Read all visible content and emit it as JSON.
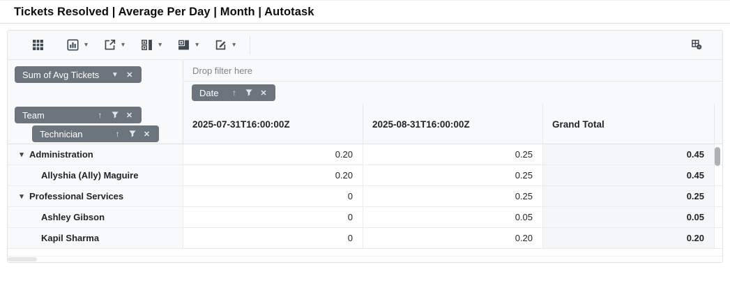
{
  "page": {
    "title": "Tickets Resolved | Average Per Day | Month | Autotask"
  },
  "toolbar": {
    "icons": [
      {
        "name": "grid-view-icon",
        "dropdown": false
      },
      {
        "name": "chart-view-icon",
        "dropdown": true
      },
      {
        "name": "export-icon",
        "dropdown": true
      },
      {
        "name": "sub-total-icon",
        "dropdown": true
      },
      {
        "name": "grand-total-icon",
        "dropdown": true
      },
      {
        "name": "formatting-icon",
        "dropdown": true
      },
      {
        "name": "field-list-icon",
        "dropdown": false
      }
    ]
  },
  "fields": {
    "values_chip": {
      "label": "Sum of Avg Tickets"
    },
    "filters_drop_label": "Drop filter here",
    "columns_chip": {
      "label": "Date"
    },
    "rows_chips": [
      {
        "label": "Team"
      },
      {
        "label": "Technician"
      }
    ]
  },
  "table": {
    "column_headers": [
      "2025-07-31T16:00:00Z",
      "2025-08-31T16:00:00Z",
      "Grand Total"
    ],
    "rows": [
      {
        "label": "Administration",
        "type": "parent",
        "expanded": true,
        "values": [
          "0.20",
          "0.25"
        ],
        "total": "0.45"
      },
      {
        "label": "Allyshia (Ally) Maguire",
        "type": "child",
        "expanded": false,
        "values": [
          "0.20",
          "0.25"
        ],
        "total": "0.45"
      },
      {
        "label": "Professional Services",
        "type": "parent",
        "expanded": true,
        "values": [
          "0",
          "0.25"
        ],
        "total": "0.25"
      },
      {
        "label": "Ashley Gibson",
        "type": "child",
        "expanded": false,
        "values": [
          "0",
          "0.05"
        ],
        "total": "0.05"
      },
      {
        "label": "Kapil Sharma",
        "type": "child",
        "expanded": false,
        "values": [
          "0",
          "0.20"
        ],
        "total": "0.20"
      }
    ]
  },
  "colors": {
    "chip_bg": "#6c757d",
    "panel_bg": "#f8f9fa",
    "grand_total_bg": "#f4f6f7",
    "border": "#dee2e6",
    "icon": "#3e4850"
  }
}
